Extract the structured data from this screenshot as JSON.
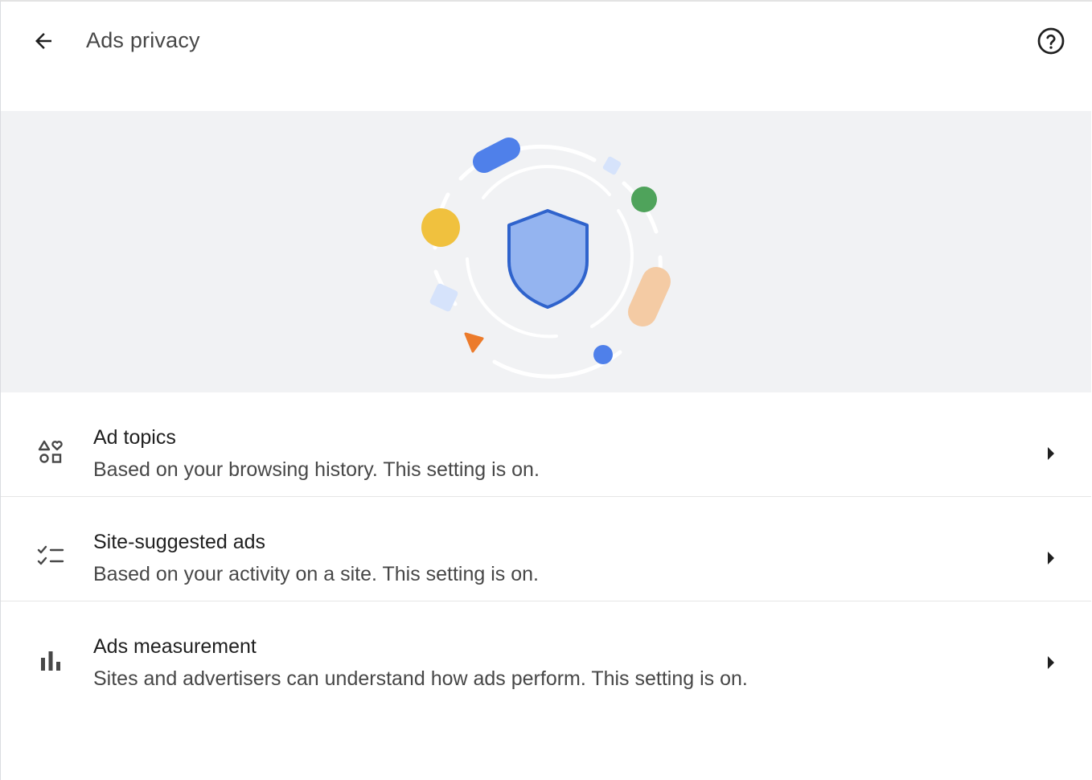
{
  "header": {
    "title": "Ads privacy",
    "back_icon": "arrow-back-icon",
    "help_icon": "help-icon"
  },
  "hero": {
    "illustration": "shield-privacy-illustration",
    "colors": {
      "background": "#f1f2f4",
      "shield_fill": "#94b4f0",
      "shield_stroke": "#2f63cc",
      "blue": "#4f80ea",
      "green": "#4fa35b",
      "yellow": "#f0c13e",
      "peach": "#f4cba4",
      "orange": "#ec7b2b",
      "light_blue": "#d6e3fb"
    }
  },
  "rows": [
    {
      "title": "Ad topics",
      "description": "Based on your browsing history. This setting is on.",
      "icon": "shapes-icon"
    },
    {
      "title": "Site-suggested ads",
      "description": "Based on your activity on a site. This setting is on.",
      "icon": "checklist-icon"
    },
    {
      "title": "Ads measurement",
      "description": "Sites and advertisers can understand how ads perform. This setting is on.",
      "icon": "bar-chart-icon"
    }
  ]
}
